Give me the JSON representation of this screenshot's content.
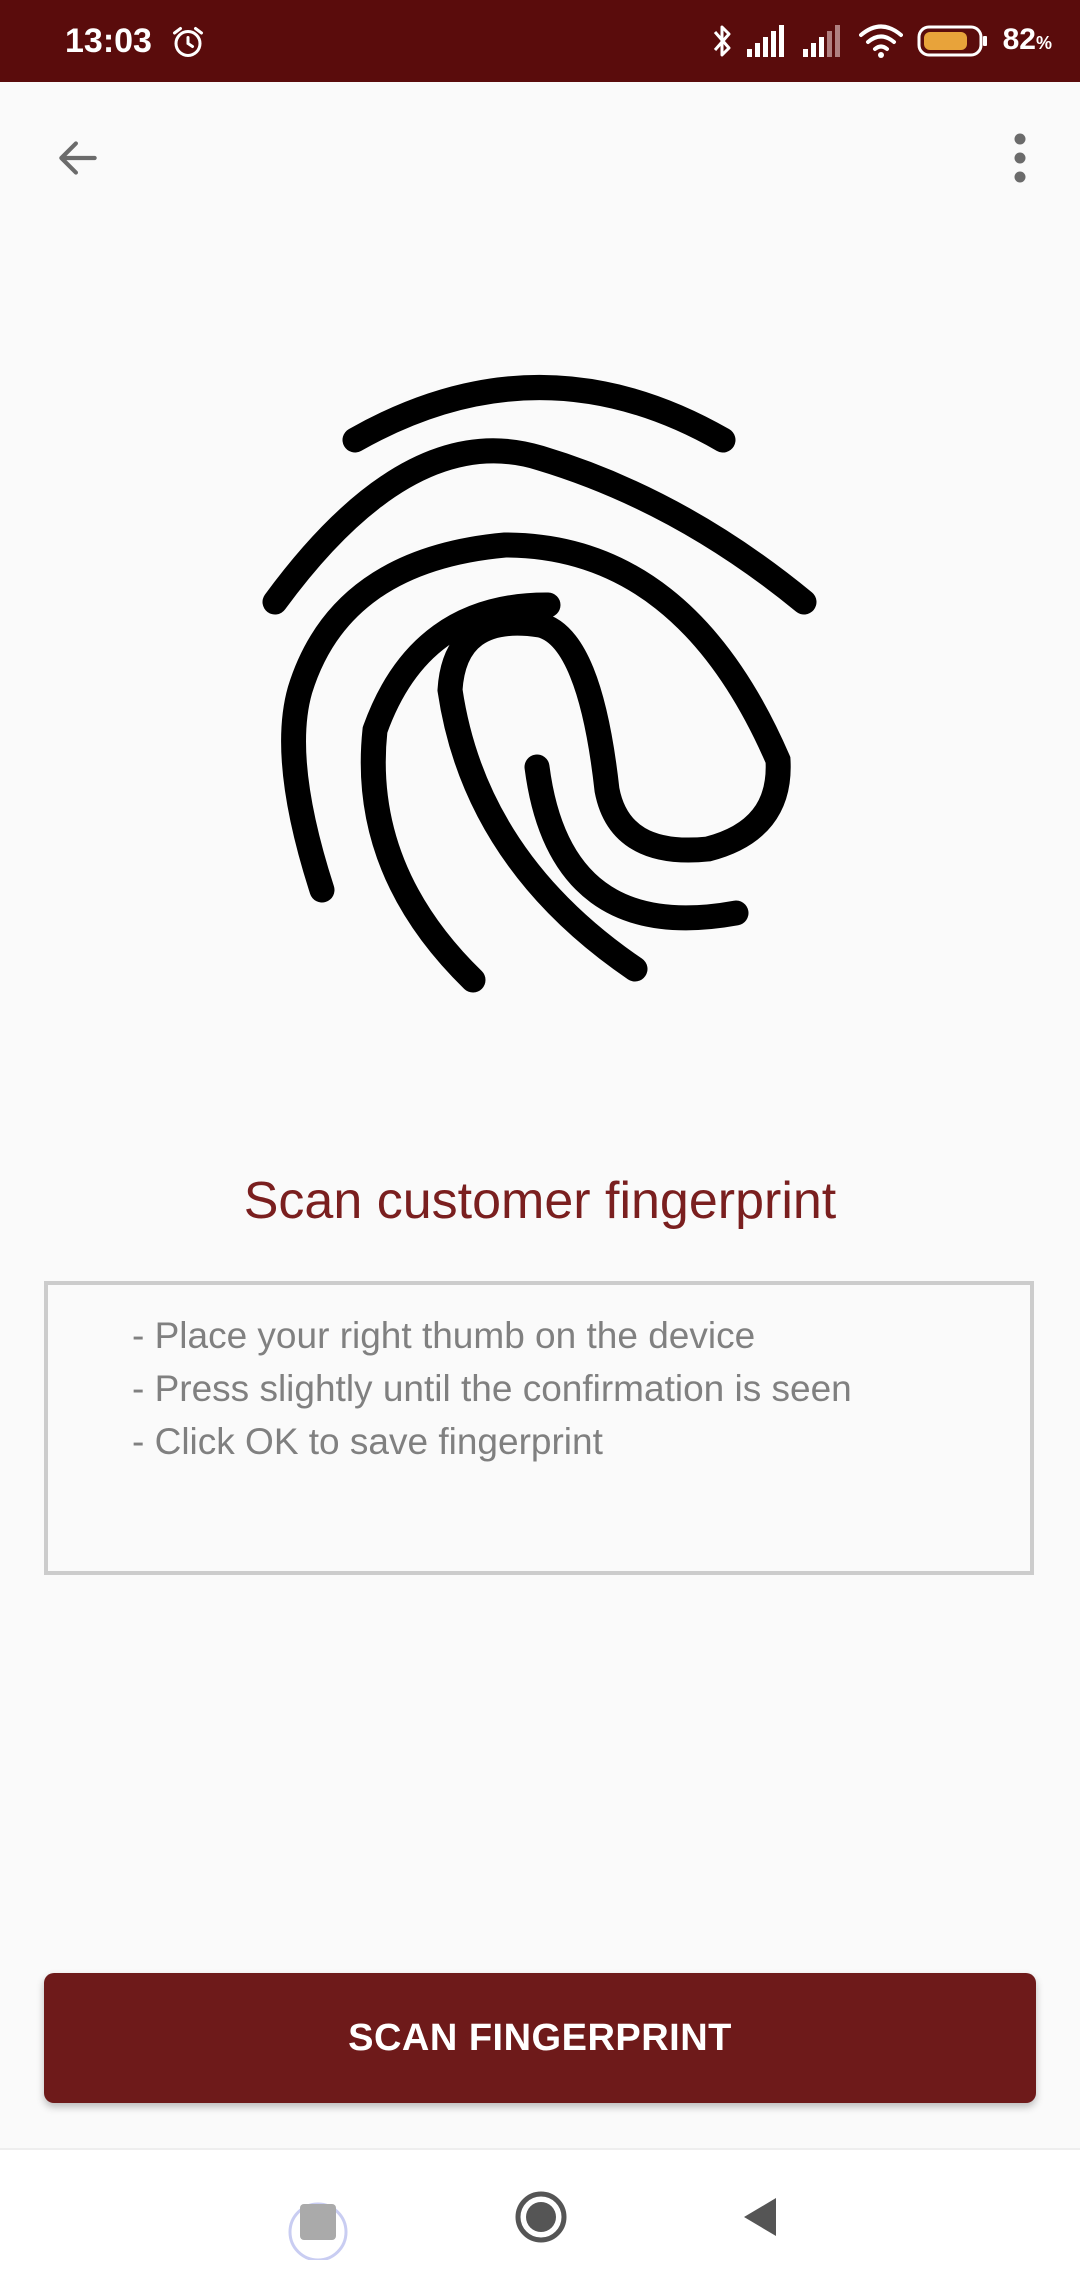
{
  "status_bar": {
    "time": "13:03",
    "battery_percent": "82",
    "battery_percent_sign": "%",
    "icons": [
      "alarm-icon",
      "bluetooth-icon",
      "signal-icon",
      "signal-icon",
      "wifi-icon",
      "battery-icon"
    ],
    "battery_level": 0.82,
    "battery_fill_color": "#e8a33a"
  },
  "app_bar": {
    "back_icon": "arrow-back-icon",
    "menu_icon": "more-vert-icon"
  },
  "illustration": {
    "icon": "fingerprint-icon"
  },
  "main": {
    "title": "Scan customer fingerprint",
    "instructions": [
      "- Place your right thumb on the device",
      "- Press slightly until the confirmation is seen",
      "- Click OK to save fingerprint"
    ]
  },
  "primary_button": {
    "label": "SCAN FINGERPRINT"
  },
  "nav_bar": {
    "icons": [
      "recents-icon",
      "home-icon",
      "back-icon"
    ]
  },
  "colors": {
    "status_bar": "#5a0c0c",
    "accent": "#7a1f1f",
    "button": "#6e1a1a",
    "background": "#fafafa",
    "instruction_text": "#808080",
    "box_border": "#cccccc"
  }
}
